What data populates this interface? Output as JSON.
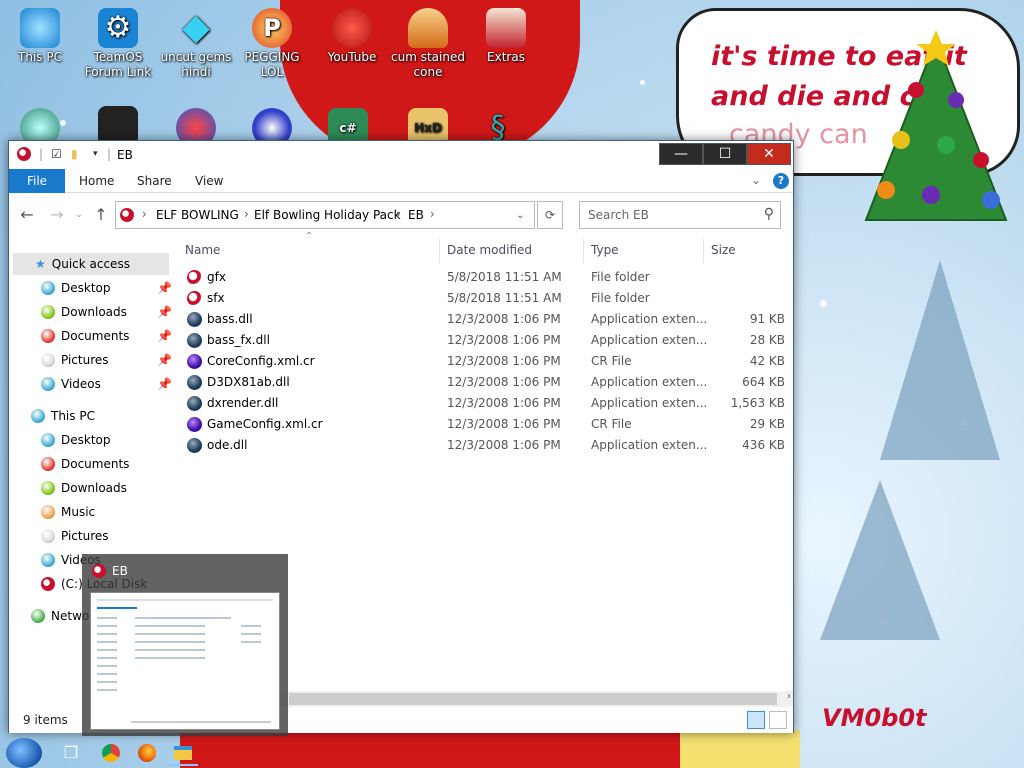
{
  "desktop": {
    "icons_row1": [
      {
        "label": "This PC",
        "icon": "computer-icon",
        "color": "#3aa7e6"
      },
      {
        "label": "TeamOS Forum Link",
        "icon": "gear-icon",
        "color": "#1a84d4"
      },
      {
        "label": "uncut gems hindi",
        "icon": "diamond-icon",
        "color": "#38d2f0"
      },
      {
        "label": "PEGGING LOL",
        "icon": "pegging-logo-icon",
        "color": "#f2a51f"
      },
      {
        "label": "YouTube",
        "icon": "angry-bird-icon",
        "color": "#d9312b"
      },
      {
        "label": "cum stained cone",
        "icon": "cone-icon",
        "color": "#e8c46d"
      },
      {
        "label": "Extras",
        "icon": "box-icon",
        "color": "#c3242f"
      }
    ],
    "speech_bubble": {
      "line1": "it's time to eat it",
      "line2": "and die and c",
      "line3": "candy can"
    },
    "signature": "VM0b0t"
  },
  "window": {
    "title": "EB",
    "ribbon_tabs": [
      "File",
      "Home",
      "Share",
      "View"
    ],
    "breadcrumbs": [
      "ELF BOWLING",
      "Elf Bowling Holiday Pack",
      "EB"
    ],
    "search_placeholder": "Search EB",
    "nav": {
      "quick_access": "Quick access",
      "quick_items": [
        "Desktop",
        "Downloads",
        "Documents",
        "Pictures",
        "Videos"
      ],
      "this_pc": "This PC",
      "pc_items": [
        "Desktop",
        "Documents",
        "Downloads",
        "Music",
        "Pictures",
        "Videos",
        "(C:) Local Disk"
      ],
      "network": "Network"
    },
    "columns": {
      "name": "Name",
      "date": "Date modified",
      "type": "Type",
      "size": "Size"
    },
    "files": [
      {
        "name": "gfx",
        "date": "5/8/2018 11:51 AM",
        "type": "File folder",
        "size": "",
        "icon": "folder"
      },
      {
        "name": "sfx",
        "date": "5/8/2018 11:51 AM",
        "type": "File folder",
        "size": "",
        "icon": "folder"
      },
      {
        "name": "bass.dll",
        "date": "12/3/2008 1:06 PM",
        "type": "Application exten...",
        "size": "91 KB",
        "icon": "app"
      },
      {
        "name": "bass_fx.dll",
        "date": "12/3/2008 1:06 PM",
        "type": "Application exten...",
        "size": "28 KB",
        "icon": "app"
      },
      {
        "name": "CoreConfig.xml.cr",
        "date": "12/3/2008 1:06 PM",
        "type": "CR File",
        "size": "42 KB",
        "icon": "cr"
      },
      {
        "name": "D3DX81ab.dll",
        "date": "12/3/2008 1:06 PM",
        "type": "Application exten...",
        "size": "664 KB",
        "icon": "app"
      },
      {
        "name": "dxrender.dll",
        "date": "12/3/2008 1:06 PM",
        "type": "Application exten...",
        "size": "1,563 KB",
        "icon": "app"
      },
      {
        "name": "GameConfig.xml.cr",
        "date": "12/3/2008 1:06 PM",
        "type": "CR File",
        "size": "29 KB",
        "icon": "cr"
      },
      {
        "name": "ode.dll",
        "date": "12/3/2008 1:06 PM",
        "type": "Application exten...",
        "size": "436 KB",
        "icon": "app"
      }
    ],
    "status": "9 items"
  },
  "thumbnail": {
    "title": "EB"
  },
  "taskbar": {
    "items": [
      "start-button",
      "task-view",
      "chrome",
      "firefox",
      "file-explorer"
    ]
  },
  "colors": {
    "accent": "#1979ca",
    "close": "#c42b1c",
    "santa_red": "#d01818",
    "bubble_text": "#c8102e"
  }
}
